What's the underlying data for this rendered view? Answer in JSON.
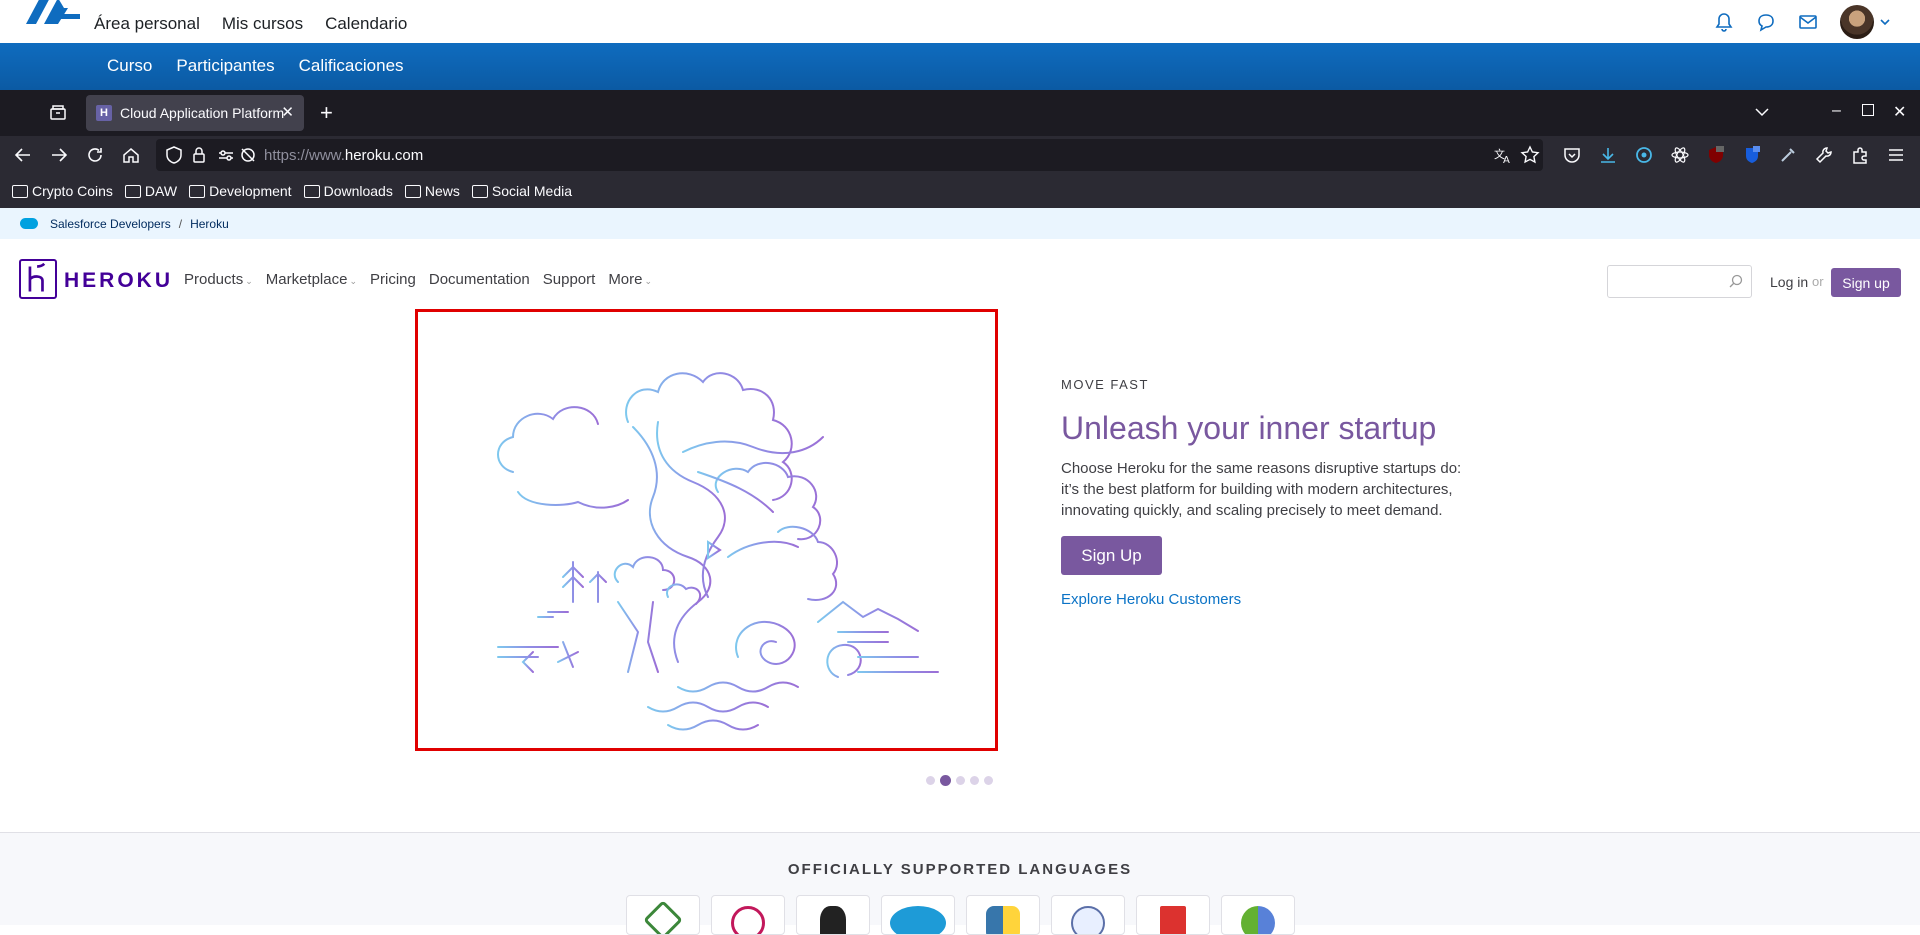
{
  "moodle": {
    "nav": [
      "Área personal",
      "Mis cursos",
      "Calendario"
    ],
    "course_nav": [
      "Curso",
      "Participantes",
      "Calificaciones"
    ]
  },
  "browser": {
    "tab_title": "Cloud Application Platform",
    "tab_favicon": "H",
    "url_prefix": "https://www.",
    "url_domain": "heroku.com",
    "bookmarks": [
      "Crypto Coins",
      "DAW",
      "Development",
      "Downloads",
      "News",
      "Social Media"
    ]
  },
  "page": {
    "breadcrumb": {
      "root": "Salesforce Developers",
      "sep": "/",
      "current": "Heroku"
    },
    "header": {
      "wordmark": "HEROKU",
      "nav": [
        "Products",
        "Marketplace",
        "Pricing",
        "Documentation",
        "Support",
        "More"
      ],
      "login": "Log in",
      "or": "or",
      "signup": "Sign up"
    },
    "hero": {
      "kicker": "MOVE FAST",
      "title": "Unleash your inner startup",
      "text": "Choose Heroku for the same reasons disruptive startups do: it’s the best platform for building with modern architectures, innovating quickly, and scaling precisely to meet demand.",
      "button": "Sign Up",
      "link": "Explore Heroku Customers",
      "carousel_active_index": 1,
      "carousel_count": 5
    },
    "languages": {
      "title": "OFFICIALLY SUPPORTED LANGUAGES",
      "items": [
        "Node.js",
        "Ruby",
        "Java",
        "PHP",
        "Python",
        "Go",
        "Scala",
        "Clojure"
      ]
    }
  },
  "colors": {
    "heroku_purple": "#79589f",
    "moodle_blue": "#0f6cbf",
    "highlight_red": "#e00000"
  }
}
